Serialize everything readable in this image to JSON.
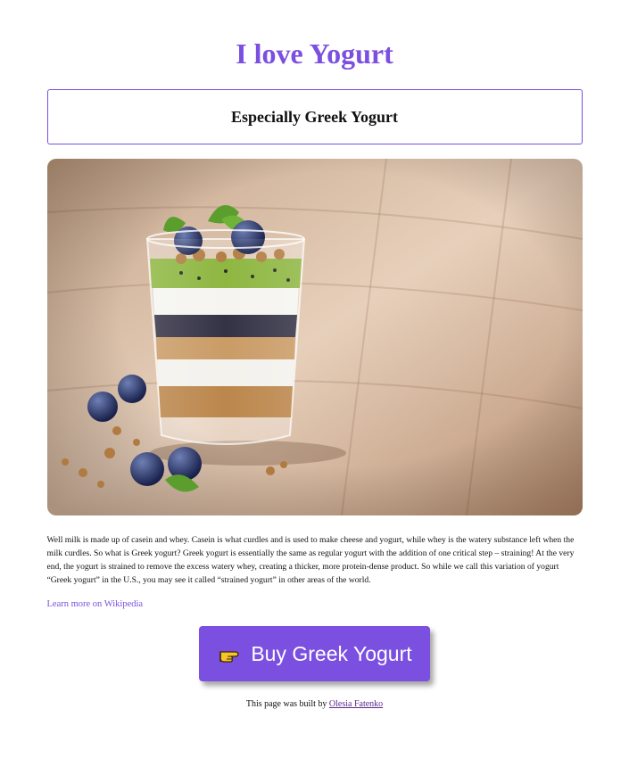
{
  "page": {
    "title": "I love Yogurt",
    "subtitle": "Especially Greek Yogurt"
  },
  "hero_image": {
    "alt": "Greek yogurt parfait with granola, kiwi and blueberries"
  },
  "content": {
    "description": "Well milk is made up of casein and whey. Casein is what curdles and is used to make cheese and yogurt, while whey is the watery substance left when the milk curdles. So what is Greek yogurt? Greek yogurt is essentially the same as regular yogurt with the addition of one critical step – straining! At the very end, the yogurt is strained to remove the excess watery whey, creating a thicker, more protein-dense product. So while we call this variation of yogurt “Greek yogurt” in the U.S., you may see it called “strained yogurt” in other areas of the world.",
    "wiki_link_label": "Learn more on Wikipedia"
  },
  "cta": {
    "buy_label": "Buy Greek Yogurt",
    "icon": "pointing-hand-icon"
  },
  "footer": {
    "prefix": "This page was built by ",
    "author": "Olesia Fatenko"
  },
  "colors": {
    "accent": "#7b4fe0",
    "author_link": "#5a2a8a"
  }
}
